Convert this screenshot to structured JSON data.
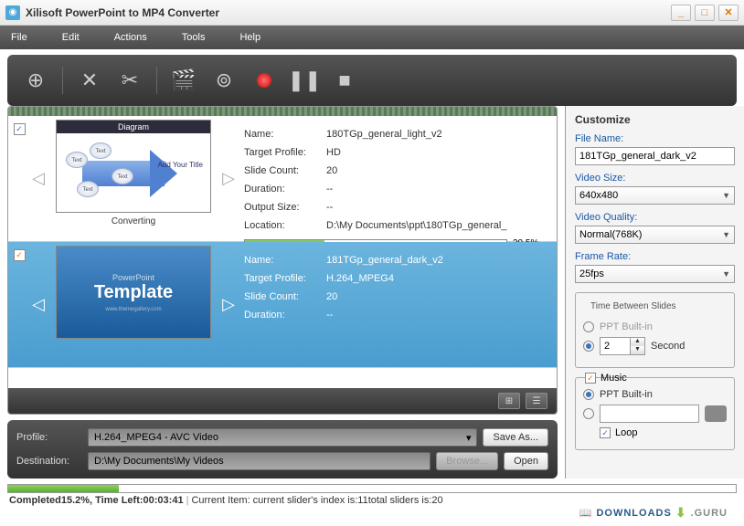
{
  "window": {
    "title": "Xilisoft PowerPoint to MP4 Converter"
  },
  "menu": [
    "File",
    "Edit",
    "Actions",
    "Tools",
    "Help"
  ],
  "items": [
    {
      "checked": true,
      "thumb_title": "Diagram",
      "thumb_caption": "Converting",
      "add_title_text": "Add Your Title",
      "bubble_text": "Text",
      "name_label": "Name:",
      "name": "180TGp_general_light_v2",
      "profile_label": "Target Profile:",
      "profile": "HD",
      "slides_label": "Slide Count:",
      "slides": "20",
      "duration_label": "Duration:",
      "duration": "--",
      "output_label": "Output Size:",
      "output": "--",
      "location_label": "Location:",
      "location": "D:\\My Documents\\ppt\\180TGp_general_",
      "progress_pct": "30.5%",
      "progress_width": "30.5%"
    },
    {
      "checked": true,
      "thumb_small": "PowerPoint",
      "thumb_big": "Template",
      "thumb_url": "www.themegallery.com",
      "name_label": "Name:",
      "name": "181TGp_general_dark_v2",
      "profile_label": "Target Profile:",
      "profile": "H.264_MPEG4",
      "slides_label": "Slide Count:",
      "slides": "20",
      "duration_label": "Duration:",
      "duration": "--"
    }
  ],
  "bottom": {
    "profile_label": "Profile:",
    "profile_value": "H.264_MPEG4 - AVC Video",
    "saveas_btn": "Save As...",
    "dest_label": "Destination:",
    "dest_value": "D:\\My Documents\\My Videos",
    "browse_btn": "Browse...",
    "open_btn": "Open"
  },
  "status": {
    "completed_prefix": "Completed ",
    "completed_pct": "15.2%",
    "time_left_label": ", Time Left:",
    "time_left": "00:03:41",
    "current_item_label": "Current Item: current slider's index is: ",
    "current_index": "11",
    "total_label": " total sliders is: ",
    "total": "20"
  },
  "customize": {
    "title": "Customize",
    "filename_label": "File Name:",
    "filename": "181TGp_general_dark_v2",
    "videosize_label": "Video Size:",
    "videosize": "640x480",
    "quality_label": "Video Quality:",
    "quality": "Normal(768K)",
    "framerate_label": "Frame Rate:",
    "framerate": "25fps",
    "time_between_title": "Time Between Slides",
    "ppt_builtin": "PPT Built-in",
    "seconds_value": "2",
    "seconds_label": "Second",
    "music_title": "Music",
    "loop_label": "Loop"
  },
  "watermark": {
    "part1": "DOWNLOADS",
    "part2": ".GURU"
  }
}
